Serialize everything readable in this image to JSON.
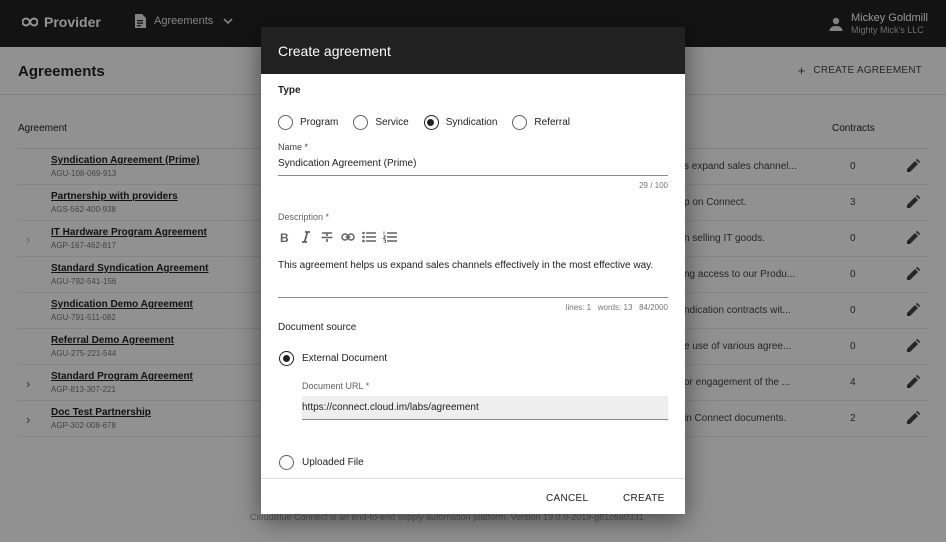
{
  "app": {
    "brand": "Provider",
    "module": "Agreements",
    "user_name": "Mickey Goldmill",
    "user_company": "Mighty Mick's LLC"
  },
  "page": {
    "title": "Agreements",
    "create_label": "CREATE AGREEMENT",
    "columns": {
      "agreement": "Agreement",
      "contracts": "Contracts"
    }
  },
  "rows": [
    {
      "name": "Syndication Agreement (Prime)",
      "id": "AGU-108-069-913",
      "desc": "s expand sales channel...",
      "count": "0",
      "expand": ""
    },
    {
      "name": "Partnership with providers",
      "id": "AGS-562-400-938",
      "desc": "p on Connect.",
      "count": "3",
      "expand": ""
    },
    {
      "name": "IT Hardware Program Agreement",
      "id": "AGP-167-462-817",
      "desc": "n selling IT goods.",
      "count": "0",
      "expand": "faint"
    },
    {
      "name": "Standard Syndication Agreement",
      "id": "AGU-792-541-156",
      "desc": "ng access to our Produ...",
      "count": "0",
      "expand": ""
    },
    {
      "name": "Syndication Demo Agreement",
      "id": "AGU-791-511-082",
      "desc": "ndication contracts wit...",
      "count": "0",
      "expand": ""
    },
    {
      "name": "Referral Demo Agreement",
      "id": "AGU-275-221-544",
      "desc": "e use of various agree...",
      "count": "0",
      "expand": ""
    },
    {
      "name": "Standard Program Agreement",
      "id": "AGP-813-307-221",
      "desc": "or engagement of the ...",
      "count": "4",
      "expand": "dark"
    },
    {
      "name": "Doc Test Partnership",
      "id": "AGP-302-008-678",
      "desc": "in Connect documents.",
      "count": "2",
      "expand": "dark"
    }
  ],
  "footer": "CloudBlue Connect is an end-to-end supply automation platform. Version 19.0.0-2019-g81c6a0331",
  "dialog": {
    "title": "Create agreement",
    "type_label": "Type",
    "type_options": [
      "Program",
      "Service",
      "Syndication",
      "Referral"
    ],
    "type_selected": "Syndication",
    "name_label": "Name *",
    "name_value": "Syndication Agreement (Prime)",
    "name_counter": "29 / 100",
    "description_label": "Description *",
    "description_value": "This agreement helps us expand sales channels effectively in the most effective way.",
    "stats": {
      "lines": "lines: 1",
      "words": "words: 13",
      "chars": "84/2000"
    },
    "source_label": "Document source",
    "source_options": {
      "external": "External Document",
      "uploaded": "Uploaded File"
    },
    "source_selected": "External Document",
    "url_label": "Document URL *",
    "url_value": "https://connect.cloud.im/labs/agreement",
    "cancel_label": "CANCEL",
    "create_label": "CREATE"
  },
  "icons": {
    "brand": "infinity-logo-icon",
    "module": "document-icon",
    "dropdown": "chevron-down-icon",
    "user": "person-icon",
    "add": "plus-icon",
    "expand": "chevron-right-icon",
    "edit": "pencil-icon",
    "toolbar": [
      "bold-icon",
      "italic-icon",
      "strikethrough-icon",
      "link-icon",
      "bulleted-list-icon",
      "numbered-list-icon"
    ]
  },
  "colors": {
    "header": "#212121",
    "scrim": "rgba(0,0,0,0.42)",
    "input_fill": "#eeeeee"
  }
}
